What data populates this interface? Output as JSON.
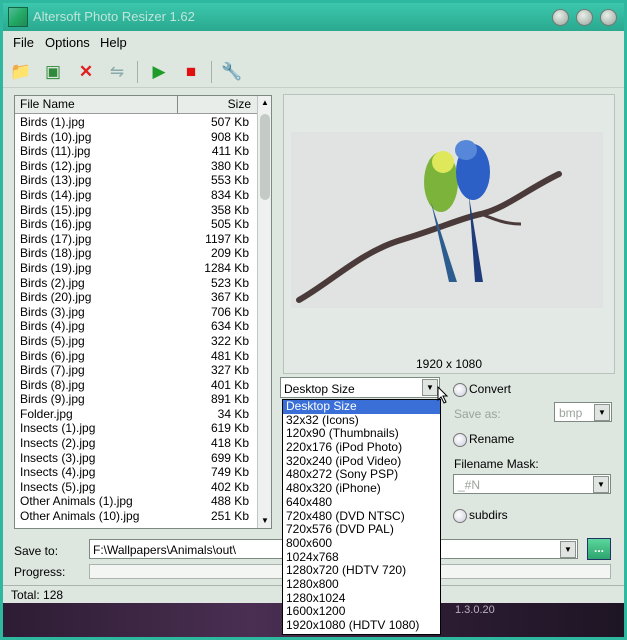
{
  "window": {
    "title": "Altersoft Photo Resizer 1.62"
  },
  "menu": {
    "file": "File",
    "options": "Options",
    "help": "Help"
  },
  "file_list": {
    "columns": {
      "name": "File Name",
      "size": "Size"
    },
    "rows": [
      {
        "name": "Birds (1).jpg",
        "size": "507 Kb"
      },
      {
        "name": "Birds (10).jpg",
        "size": "908 Kb"
      },
      {
        "name": "Birds (11).jpg",
        "size": "411 Kb"
      },
      {
        "name": "Birds (12).jpg",
        "size": "380 Kb"
      },
      {
        "name": "Birds (13).jpg",
        "size": "553 Kb"
      },
      {
        "name": "Birds (14).jpg",
        "size": "834 Kb"
      },
      {
        "name": "Birds (15).jpg",
        "size": "358 Kb"
      },
      {
        "name": "Birds (16).jpg",
        "size": "505 Kb"
      },
      {
        "name": "Birds (17).jpg",
        "size": "1197 Kb"
      },
      {
        "name": "Birds (18).jpg",
        "size": "209 Kb"
      },
      {
        "name": "Birds (19).jpg",
        "size": "1284 Kb"
      },
      {
        "name": "Birds (2).jpg",
        "size": "523 Kb"
      },
      {
        "name": "Birds (20).jpg",
        "size": "367 Kb"
      },
      {
        "name": "Birds (3).jpg",
        "size": "706 Kb"
      },
      {
        "name": "Birds (4).jpg",
        "size": "634 Kb"
      },
      {
        "name": "Birds (5).jpg",
        "size": "322 Kb"
      },
      {
        "name": "Birds (6).jpg",
        "size": "481 Kb"
      },
      {
        "name": "Birds (7).jpg",
        "size": "327 Kb"
      },
      {
        "name": "Birds (8).jpg",
        "size": "401 Kb"
      },
      {
        "name": "Birds (9).jpg",
        "size": "891 Kb"
      },
      {
        "name": "Folder.jpg",
        "size": "34 Kb"
      },
      {
        "name": "Insects (1).jpg",
        "size": "619 Kb"
      },
      {
        "name": "Insects (2).jpg",
        "size": "418 Kb"
      },
      {
        "name": "Insects (3).jpg",
        "size": "699 Kb"
      },
      {
        "name": "Insects (4).jpg",
        "size": "749 Kb"
      },
      {
        "name": "Insects (5).jpg",
        "size": "402 Kb"
      },
      {
        "name": "Other Animals (1).jpg",
        "size": "488 Kb"
      },
      {
        "name": "Other Animals (10).jpg",
        "size": "251 Kb"
      }
    ]
  },
  "preview": {
    "dimensions": "1920 x 1080"
  },
  "size_preset": {
    "selected": "Desktop Size",
    "options": [
      "Desktop Size",
      "32x32 (Icons)",
      "120x90 (Thumbnails)",
      "220x176 (iPod Photo)",
      "320x240 (iPod Video)",
      "480x272 (Sony PSP)",
      "480x320 (iPhone)",
      "640x480",
      "720x480 (DVD NTSC)",
      "720x576 (DVD PAL)",
      "800x600",
      "1024x768",
      "1280x720 (HDTV 720)",
      "1280x800",
      "1280x1024",
      "1600x1200",
      "1920x1080 (HDTV 1080)"
    ]
  },
  "options": {
    "convert": "Convert",
    "save_as_label": "Save as:",
    "save_as_value": "bmp",
    "rename": "Rename",
    "mask_label": "Filename Mask:",
    "mask_value": "_#N",
    "subdirs": "subdirs"
  },
  "save_to": {
    "label": "Save to:",
    "value": "F:\\Wallpapers\\Animals\\out\\",
    "browse": "..."
  },
  "progress": {
    "label": "Progress:",
    "value": 0
  },
  "status": {
    "total": "Total: 128"
  },
  "desktop": {
    "version_text": "1.3.0.20"
  },
  "colors": {
    "titlebar": "#2fb8a0",
    "selection": "#3a6fd8",
    "window_bg": "#dde6df"
  }
}
